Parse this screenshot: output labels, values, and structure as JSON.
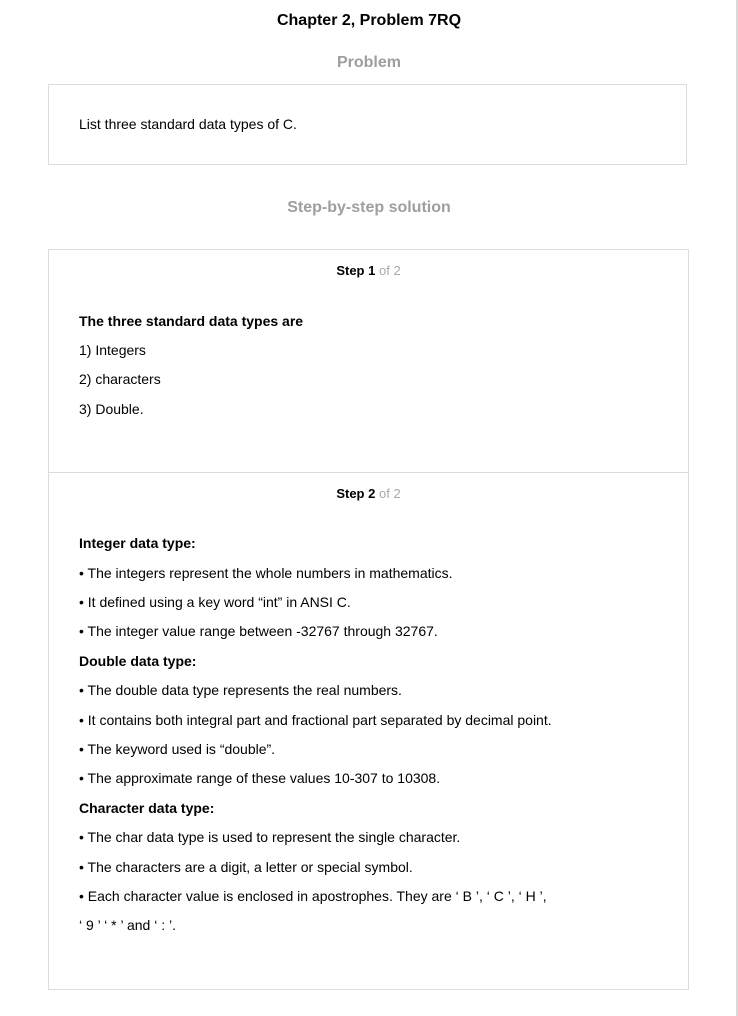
{
  "title": "Chapter 2, Problem 7RQ",
  "problem": {
    "heading": "Problem",
    "text": "List three standard data types of C."
  },
  "solution": {
    "heading": "Step-by-step solution",
    "step_word": "Step",
    "of_text": "of 2",
    "steps": [
      {
        "number": "1",
        "lines": [
          {
            "text": "The three standard data types are",
            "bold": true
          },
          {
            "text": "1) Integers",
            "bold": false
          },
          {
            "text": "2) characters",
            "bold": false
          },
          {
            "text": "3) Double.",
            "bold": false
          }
        ]
      },
      {
        "number": "2",
        "lines": [
          {
            "text": "Integer data type:",
            "bold": true
          },
          {
            "text": "• The integers represent the whole numbers in mathematics.",
            "bold": false
          },
          {
            "text": "• It defined using a key word “int” in ANSI C.",
            "bold": false
          },
          {
            "text": "• The integer value range between -32767 through 32767.",
            "bold": false
          },
          {
            "text": "Double data type:",
            "bold": true
          },
          {
            "text": "• The double data type represents the real numbers.",
            "bold": false
          },
          {
            "text": "• It contains both integral part and fractional part separated by decimal point.",
            "bold": false
          },
          {
            "text": "• The keyword used is “double”.",
            "bold": false
          },
          {
            "text": "• The approximate range of these values 10-307 to 10308.",
            "bold": false
          },
          {
            "text": "Character data type:",
            "bold": true
          },
          {
            "text": "• The char data type is used to represent the single character.",
            "bold": false
          },
          {
            "text": "• The characters are a digit, a letter or special symbol.",
            "bold": false
          },
          {
            "text": "• Each character value is enclosed in apostrophes. They are ‘ B ’, ‘ C ’, ‘ H ’,",
            "bold": false
          },
          {
            "text": "‘ 9 ’ ‘ * ’ and ‘ : ’.",
            "bold": false
          }
        ]
      }
    ]
  }
}
